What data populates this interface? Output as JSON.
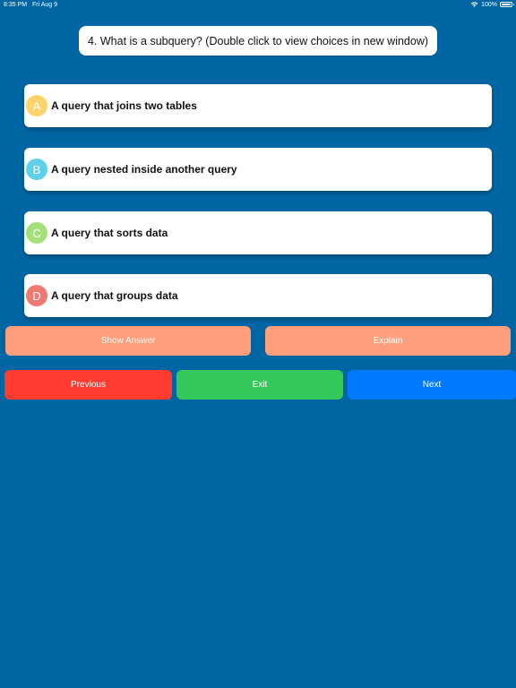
{
  "status_bar": {
    "time": "8:35 PM",
    "date": "Fri Aug 9",
    "battery": "100%"
  },
  "question": {
    "text": "4. What is a subquery? (Double click to view choices in new window)"
  },
  "choices": [
    {
      "letter": "A",
      "text": "A query that joins two tables",
      "color": "#ffd36b"
    },
    {
      "letter": "B",
      "text": "A query nested inside another query",
      "color": "#5fd0ea"
    },
    {
      "letter": "C",
      "text": "A query that sorts data",
      "color": "#a4e07a"
    },
    {
      "letter": "D",
      "text": "A query that groups data",
      "color": "#f07a72"
    }
  ],
  "actions": {
    "show_answer": "Show Answer",
    "explain": "Explain"
  },
  "navigation": {
    "previous": "Previous",
    "exit": "Exit",
    "next": "Next"
  },
  "colors": {
    "background": "#0066a3",
    "action_button": "#ff9e7a",
    "previous": "#ff3b30",
    "exit": "#34c759",
    "next": "#007aff"
  }
}
